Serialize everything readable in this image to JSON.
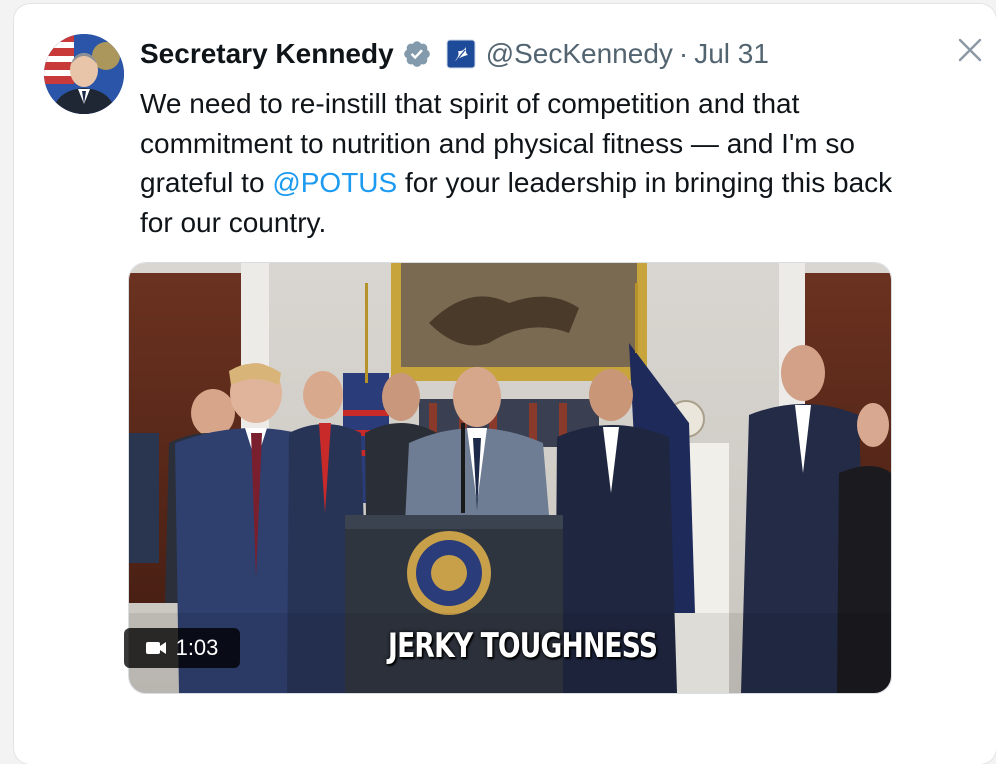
{
  "tweet": {
    "author_name": "Secretary Kennedy",
    "handle": "@SecKennedy",
    "separator": "·",
    "date": "Jul 31",
    "text_before_mention": "We need to re-instill that spirit of competition and that commitment to nutrition and physical fitness — and I'm so grateful to ",
    "mention": "@POTUS",
    "text_after_mention": " for your leadership in bringing this back for our country."
  },
  "video": {
    "duration": "1:03",
    "caption": "JERKY TOUGHNESS"
  },
  "icons": {
    "verified": "verified-badge-icon",
    "affiliation": "hhs-affiliation-icon",
    "close": "close-icon"
  },
  "colors": {
    "mention": "#1d9bf0",
    "verified_badge": "#829aab",
    "affiliation_bg": "#1e4a9a"
  }
}
